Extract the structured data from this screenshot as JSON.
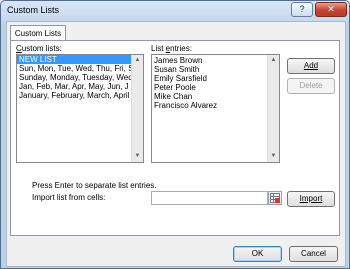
{
  "window": {
    "title": "Custom Lists",
    "help_glyph": "?",
    "close_glyph": "✕"
  },
  "tab": {
    "label": "Custom Lists"
  },
  "custom_lists": {
    "label": "Custom lists:",
    "items": [
      "NEW LIST",
      "Sun, Mon, Tue, Wed, Thu, Fri, S",
      "Sunday, Monday, Tuesday, Wed",
      "Jan, Feb, Mar, Apr, May, Jun, J",
      "January, February, March, April"
    ],
    "selected_index": 0
  },
  "list_entries": {
    "label": "List entries:",
    "items": [
      "James Brown",
      "Susan Smith",
      "Emily Sarsfield",
      "Peter Poole",
      "Mike Chan",
      "Francisco Alvarez"
    ]
  },
  "buttons": {
    "add": "Add",
    "delete": "Delete",
    "import": "Import",
    "ok": "OK",
    "cancel": "Cancel"
  },
  "hint": "Press Enter to separate list entries.",
  "import_field": {
    "label": "Import list from cells:",
    "value": ""
  },
  "colors": {
    "selection": "#3399ff",
    "close_button": "#c7432b"
  }
}
